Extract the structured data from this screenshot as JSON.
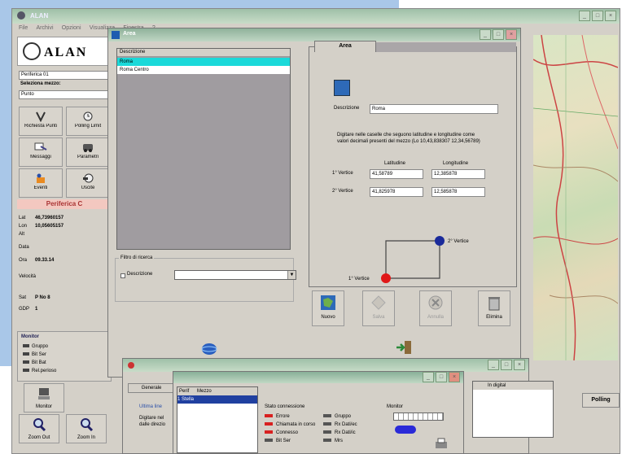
{
  "app": {
    "title": "ALAN"
  },
  "menu": [
    "File",
    "Archivi",
    "Opzioni",
    "Visualizza",
    "Finestra",
    "?"
  ],
  "left": {
    "brand": "ALAN",
    "field1": "Periferica 01",
    "label1": "Seleziona mezzo:",
    "field2": "Punto",
    "tools": [
      {
        "label": "Richiesta Punti",
        "icon": "request-points-icon"
      },
      {
        "label": "Polling Limit",
        "icon": "clock-icon"
      },
      {
        "label": "Messaggi",
        "icon": "message-icon"
      },
      {
        "label": "Parametri",
        "icon": "car-icon"
      },
      {
        "label": "Eventi",
        "icon": "event-icon"
      },
      {
        "label": "Uscite",
        "icon": "switch-icon"
      }
    ],
    "profile_title": "Periferica C",
    "values": [
      {
        "k": "Lat",
        "v": "46,73960157"
      },
      {
        "k": "Lon",
        "v": "10,05605157"
      },
      {
        "k": "Alt",
        "v": ""
      },
      {
        "k": "Data",
        "v": ""
      },
      {
        "k": "Ora",
        "v": "09.33.14"
      },
      {
        "k": "Velocità",
        "v": ""
      },
      {
        "k": "Sat",
        "v": "P  No  8"
      },
      {
        "k": "GDP",
        "v": "1"
      }
    ],
    "monitor": {
      "title": "Monitor",
      "items": [
        "Gruppo",
        "Bit Ser",
        "Bit Bat",
        "Rel.perioso"
      ]
    },
    "bottom_tools": [
      {
        "label": "Monitor",
        "icon": "monitor-icon"
      },
      {
        "label": "Zoom Out",
        "icon": "zoom-out-icon"
      },
      {
        "label": "Zoom In",
        "icon": "zoom-in-icon"
      }
    ]
  },
  "dialog": {
    "title": "Area",
    "list_header": "Descrizione",
    "rows": [
      {
        "text": "Roma",
        "selected": true
      },
      {
        "text": "Roma Centro",
        "selected": false
      }
    ],
    "filter": {
      "title": "Filtro di ricerca",
      "checkbox_label": "Descrizione",
      "value": ""
    },
    "tab": "Area",
    "desc_label": "Descrizione",
    "desc_value": "Roma",
    "note": "Digitare nelle caselle che seguono latitudine e longitudine come valori decimali presenti del mezzo (Lo 10,43,838307 12,34,56789)",
    "lat_header": "Latitudine",
    "lon_header": "Longitudine",
    "v1_label": "1° Vertice",
    "v1_lat": "41,58789",
    "v1_lon": "12,385878",
    "v2_label": "2° Vertice",
    "v2_lat": "41,825978",
    "v2_lon": "12,585878",
    "diagram": {
      "v1": "1° Vertice",
      "v2": "2° Vertice"
    },
    "actions": [
      {
        "label": "Nuovo",
        "icon": "map-new-icon",
        "disabled": false
      },
      {
        "label": "Salva",
        "icon": "save-icon",
        "disabled": true
      },
      {
        "label": "Annulla",
        "icon": "cancel-icon",
        "disabled": true
      },
      {
        "label": "Elimina",
        "icon": "trash-icon",
        "disabled": false
      }
    ]
  },
  "win2": {
    "tab": "Generale",
    "text1": "Ultima line",
    "text2": "Digitare nel",
    "text3": "dalle direzio"
  },
  "win3": {
    "list_headers": [
      "Perif",
      "Mezzo"
    ],
    "selected_row": "1  Stella",
    "group_title": "Stato connessione",
    "legend": [
      "Errore",
      "Chiamata in corso",
      "Connesso",
      "Bit Ser"
    ],
    "legend_right": [
      "Gruppo",
      "Rx Dati/ec",
      "Rx Dati/ic",
      "Mrs"
    ],
    "monitor_label": "Monitor"
  },
  "polling_button": "Polling",
  "sidelist_header": "In digital",
  "colors": {
    "selection": "#1bd9d9",
    "accent_red": "#d82020",
    "accent_blue": "#1a2a9a"
  }
}
